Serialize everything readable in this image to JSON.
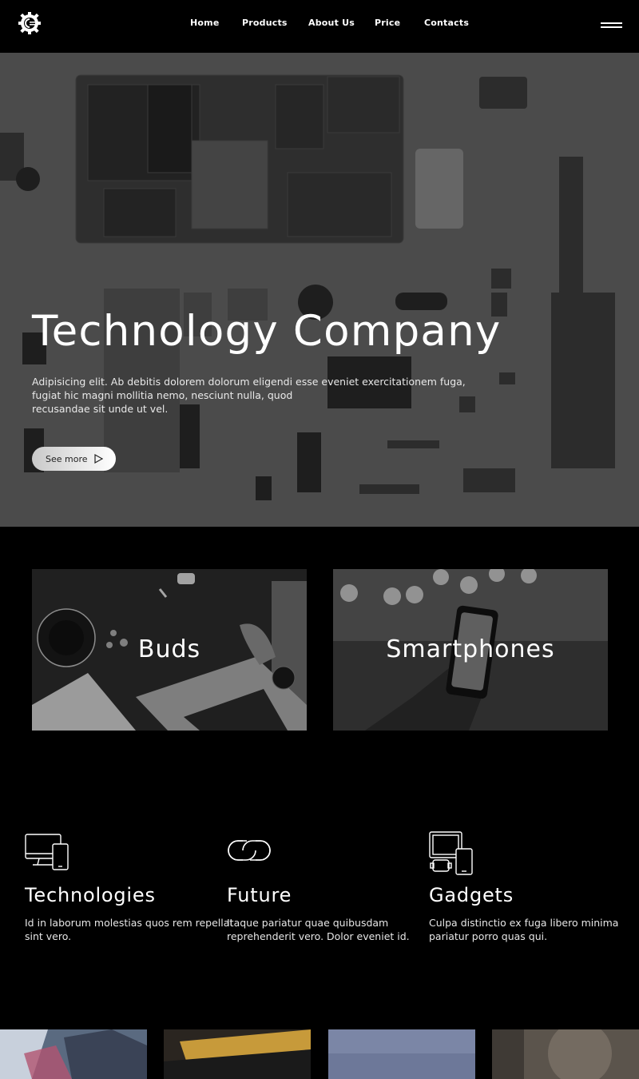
{
  "header": {
    "logo_icon": "gear-logo-icon",
    "nav": [
      "Home",
      "Products",
      "About Us",
      "Price",
      "Contacts"
    ],
    "menu_icon": "hamburger-menu-icon"
  },
  "hero": {
    "title": "Technology Company",
    "description_lines": [
      "Adipisicing elit. Ab debitis dolorem dolorum eligendi esse eveniet exercitationem fuga,",
      "fugiat hic magni mollitia nemo, nesciunt nulla, quod",
      "recusandae sit unde ut vel."
    ],
    "button_label": "See more",
    "button_icon": "play-triangle-icon"
  },
  "categories": [
    {
      "label": "Buds"
    },
    {
      "label": "Smartphones"
    }
  ],
  "features": [
    {
      "icon": "desktop-and-phone-icon",
      "title": "Technologies",
      "description_lines": [
        "Id in laborum molestias quos rem repellat",
        "sint vero."
      ]
    },
    {
      "icon": "link-chain-icon",
      "title": "Future",
      "description_lines": [
        "Itaque pariatur quae quibusdam",
        "reprehenderit vero. Dolor eveniet id."
      ]
    },
    {
      "icon": "devices-icon",
      "title": "Gadgets",
      "description_lines": [
        "Culpa distinctio ex fuga libero minima",
        "pariatur porro quas qui."
      ]
    }
  ],
  "colors": {
    "background": "#000000",
    "hero_overlay": "#4a4a4a",
    "text": "#ffffff",
    "button": "#e6e6e6"
  }
}
